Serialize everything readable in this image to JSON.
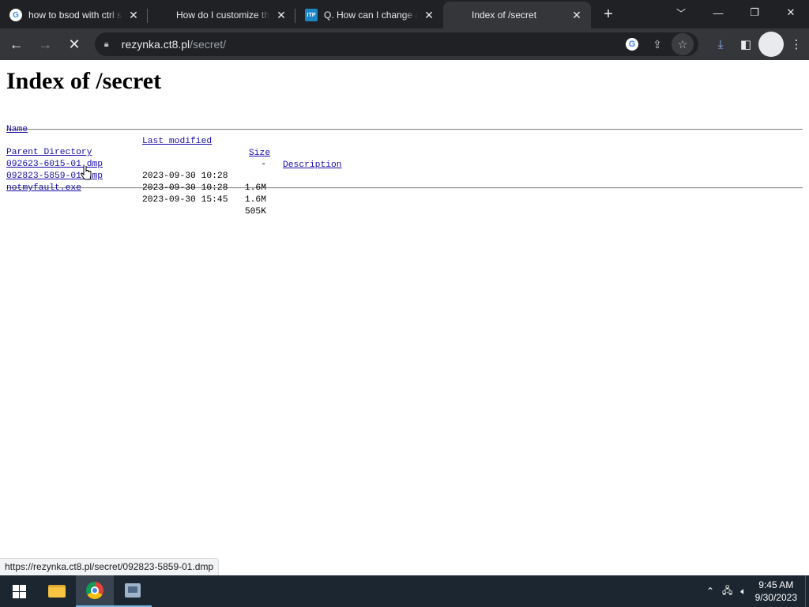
{
  "tabs": [
    {
      "title": "how to bsod with ctrl scroll lock",
      "icon": "google-icon",
      "active": false
    },
    {
      "title": "How do I customize the",
      "icon": "microsoft-icon",
      "active": false
    },
    {
      "title": "Q. How can I change a",
      "icon": "itpro-icon",
      "active": false
    },
    {
      "title": "Index of /secret",
      "icon": "blank-icon",
      "active": true
    }
  ],
  "toolbar": {
    "url_host": "rezynka.ct8.pl",
    "url_path": "/secret/"
  },
  "page": {
    "heading": "Index of /secret",
    "columns": {
      "name": "Name",
      "last_modified": "Last modified",
      "size": "Size",
      "description": "Description"
    },
    "parent": {
      "name": "Parent Directory",
      "size": "-"
    },
    "files": [
      {
        "name": "092623-6015-01.dmp",
        "modified": "2023-09-30 10:28",
        "size": "1.6M"
      },
      {
        "name": "092823-5859-01.dmp",
        "modified": "2023-09-30 10:28",
        "size": "1.6M"
      },
      {
        "name": "notmyfault.exe",
        "modified": "2023-09-30 15:45",
        "size": "505K"
      }
    ]
  },
  "status_url": "https://rezynka.ct8.pl/secret/092823-5859-01.dmp",
  "taskbar": {
    "time": "9:45 AM",
    "date": "9/30/2023"
  }
}
